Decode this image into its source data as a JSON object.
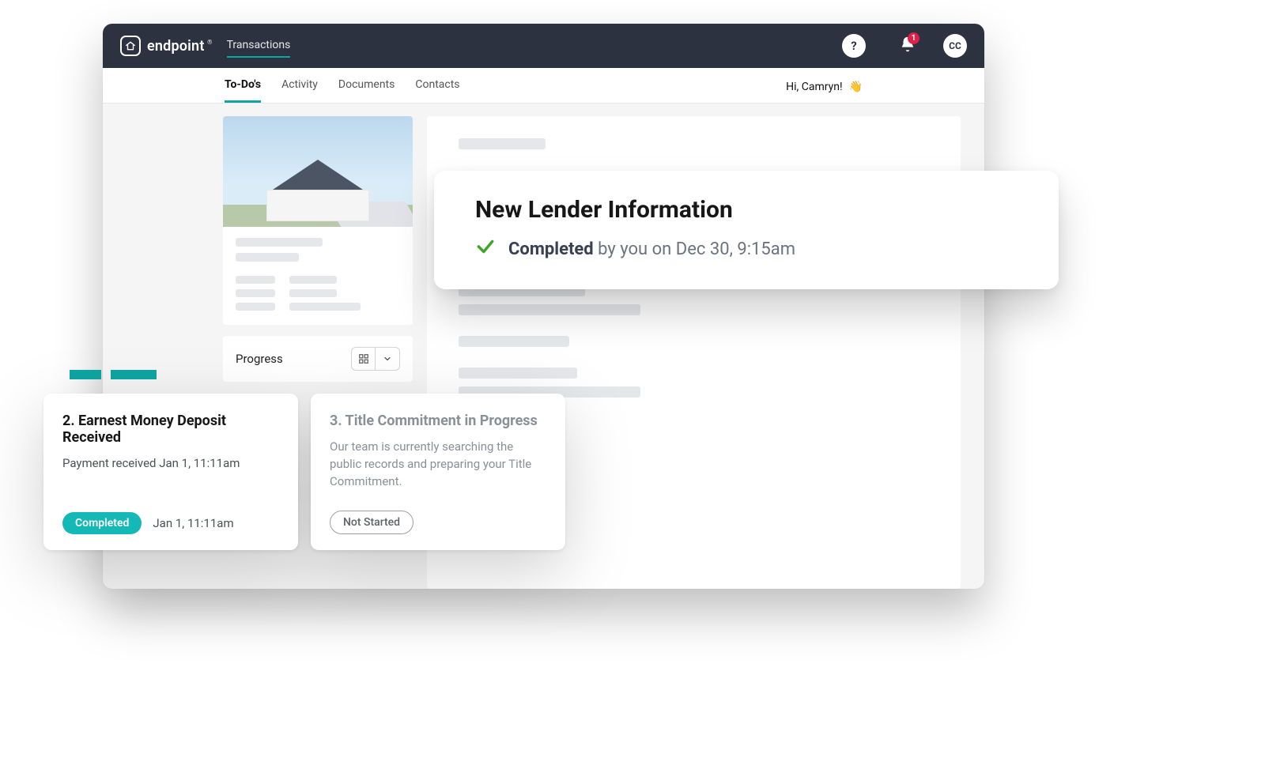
{
  "topbar": {
    "brand": "endpoint",
    "nav_transactions": "Transactions",
    "notif_count": "1",
    "avatar_initials": "CC"
  },
  "subnav": {
    "tabs": {
      "todos": "To-Do's",
      "activity": "Activity",
      "documents": "Documents",
      "contacts": "Contacts"
    },
    "greeting": "Hi, Camryn!",
    "greeting_emoji": "👋"
  },
  "progress_section": {
    "label": "Progress"
  },
  "lender_callout": {
    "title": "New Lender Information",
    "status_word": "Completed",
    "status_rest": " by you on Dec 30, 9:15am"
  },
  "progress_cards": {
    "card1": {
      "title": "2. Earnest Money Deposit Received",
      "sub": "Payment received Jan 1, 11:11am",
      "pill": "Completed",
      "timestamp": "Jan 1, 11:11am"
    },
    "card2": {
      "title": "3. Title Commitment in Progress",
      "sub": "Our team is currently searching the public records and preparing your Title Commitment.",
      "pill": "Not Started"
    }
  }
}
